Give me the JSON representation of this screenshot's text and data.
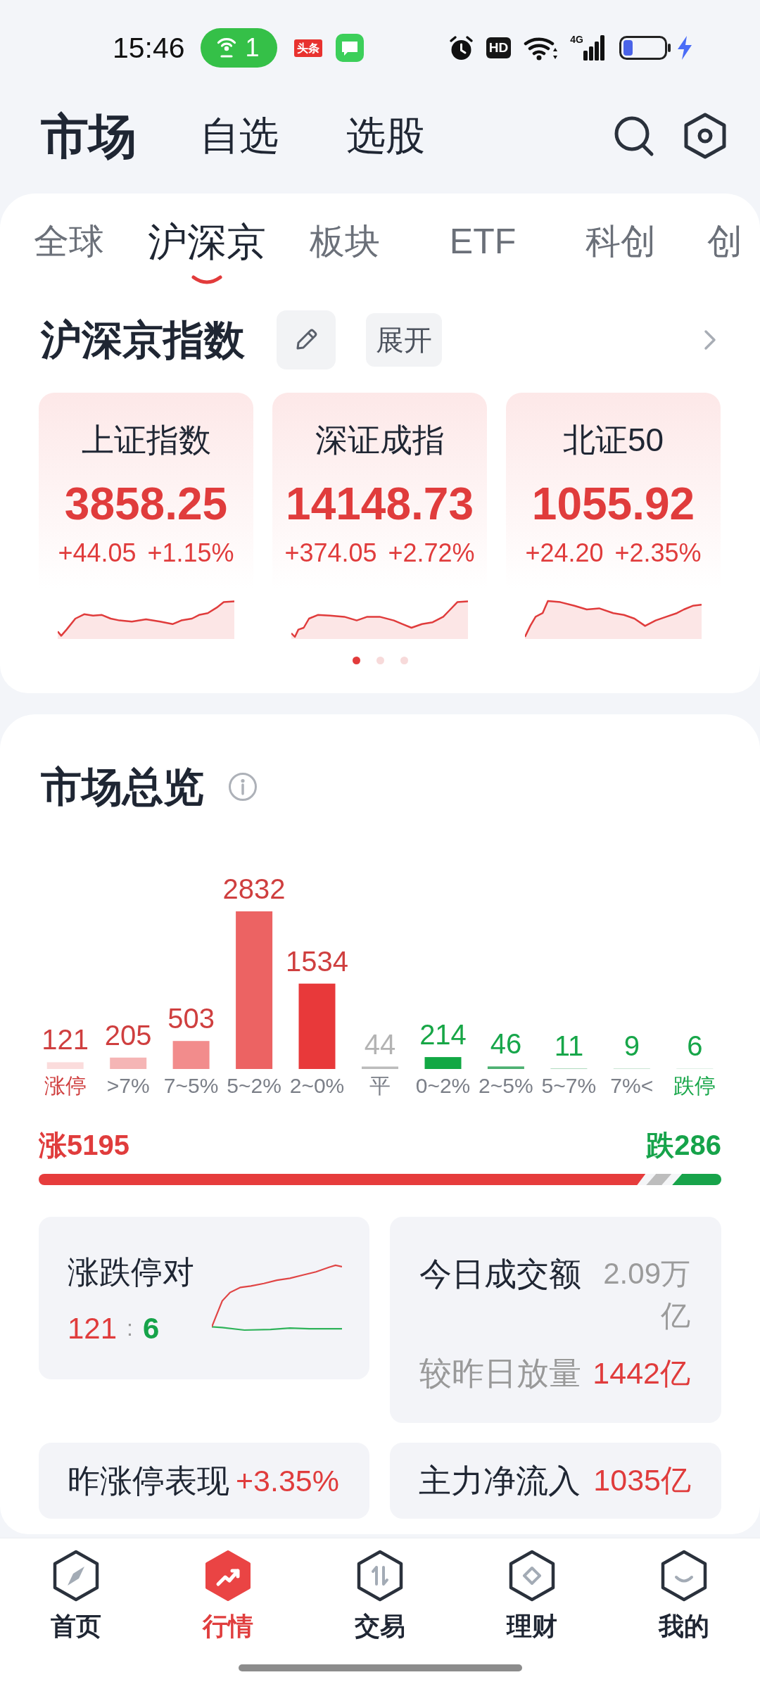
{
  "status_bar": {
    "time": "15:46",
    "hotspot_count": "1",
    "app_badge": "头条",
    "hd_label": "HD",
    "network_label": "4G"
  },
  "header_tabs": [
    {
      "label": "市场",
      "selected": true
    },
    {
      "label": "自选",
      "selected": false
    },
    {
      "label": "选股",
      "selected": false
    }
  ],
  "market_tabs": [
    {
      "label": "全球",
      "selected": false
    },
    {
      "label": "沪深京",
      "selected": true
    },
    {
      "label": "板块",
      "selected": false
    },
    {
      "label": "ETF",
      "selected": false
    },
    {
      "label": "科创",
      "selected": false
    },
    {
      "label": "创",
      "selected": false
    }
  ],
  "index_section": {
    "title": "沪深京指数",
    "expand_button": "展开",
    "cards": [
      {
        "name": "上证指数",
        "value": "3858.25",
        "change": "+44.05",
        "change_percent": "+1.15%"
      },
      {
        "name": "深证成指",
        "value": "14148.73",
        "change": "+374.05",
        "change_percent": "+2.72%"
      },
      {
        "name": "北证50",
        "value": "1055.92",
        "change": "+24.20",
        "change_percent": "+2.35%"
      }
    ],
    "pager": [
      {
        "selected": true
      },
      {
        "selected": false
      },
      {
        "selected": false
      }
    ]
  },
  "overview": {
    "title": "市场总览",
    "chart_data": {
      "type": "bar",
      "categories": [
        "涨停",
        ">7%",
        "7~5%",
        "5~2%",
        "2~0%",
        "平",
        "0~2%",
        "2~5%",
        "5~7%",
        "7%<",
        "跌停"
      ],
      "series": [
        {
          "color": "#fbdcdc",
          "values": [
            121,
            null,
            null,
            null,
            null,
            null,
            null,
            null,
            null,
            null,
            null
          ]
        },
        {
          "color": "#f5b5b5",
          "values": [
            null,
            205,
            null,
            null,
            null,
            null,
            null,
            null,
            null,
            null,
            null
          ]
        },
        {
          "color": "#f28c8c",
          "values": [
            null,
            null,
            503,
            null,
            null,
            null,
            null,
            null,
            null,
            null,
            null
          ]
        },
        {
          "color": "#ec6363",
          "values": [
            null,
            null,
            null,
            2832,
            null,
            null,
            null,
            null,
            null,
            null,
            null
          ]
        },
        {
          "color": "#e8393a",
          "values": [
            null,
            null,
            null,
            null,
            1534,
            null,
            null,
            null,
            null,
            null,
            null
          ]
        },
        {
          "color": "#bcbcbc",
          "values": [
            null,
            null,
            null,
            null,
            null,
            44,
            null,
            null,
            null,
            null,
            null
          ]
        },
        {
          "color": "#12a844",
          "values": [
            null,
            null,
            null,
            null,
            null,
            null,
            214,
            null,
            null,
            null,
            null
          ]
        },
        {
          "color": "#4cb071",
          "values": [
            null,
            null,
            null,
            null,
            null,
            null,
            null,
            46,
            null,
            null,
            null
          ]
        },
        {
          "color": "#b0dbbf",
          "values": [
            null,
            null,
            null,
            null,
            null,
            null,
            null,
            null,
            11,
            null,
            null
          ]
        },
        {
          "color": "#cae6d4",
          "values": [
            null,
            null,
            null,
            null,
            null,
            null,
            null,
            null,
            null,
            9,
            null
          ]
        },
        {
          "color": "#dff0e5",
          "values": [
            null,
            null,
            null,
            null,
            null,
            null,
            null,
            null,
            null,
            null,
            6
          ]
        }
      ],
      "stacked": true,
      "data_labels": true
    },
    "breadth": {
      "up_label": "涨5195",
      "down_label": "跌286",
      "rise": {
        "level": 0.889
      },
      "fall": {
        "level": 0.072
      }
    },
    "stat_cards": [
      {
        "kind": "limit_ratio",
        "title": "涨跌停对",
        "up": "121",
        "separator": ":",
        "down": "6"
      },
      {
        "kind": "turnover",
        "title": "今日成交额",
        "value": "2.09万亿",
        "compare_label": "较昨日放量",
        "compare_value": "1442亿"
      },
      {
        "kind": "inline",
        "title": "昨涨停表现",
        "value": "+3.35%"
      },
      {
        "kind": "inline",
        "title": "主力净流入",
        "value": "1035亿"
      }
    ]
  },
  "bottom_nav": [
    {
      "label": "首页",
      "selected": false
    },
    {
      "label": "行情",
      "selected": true
    },
    {
      "label": "交易",
      "selected": false
    },
    {
      "label": "理财",
      "selected": false
    },
    {
      "label": "我的",
      "selected": false
    }
  ]
}
